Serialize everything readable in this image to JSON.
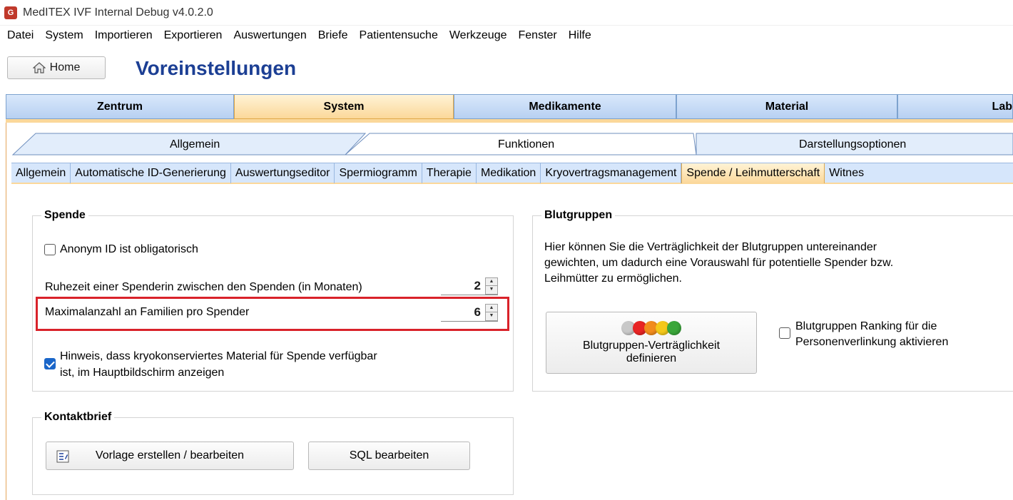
{
  "window": {
    "title": "MedITEX IVF Internal Debug v4.0.2.0",
    "icon_label": "G"
  },
  "menu": [
    "Datei",
    "System",
    "Importieren",
    "Exportieren",
    "Auswertungen",
    "Briefe",
    "Patientensuche",
    "Werkzeuge",
    "Fenster",
    "Hilfe"
  ],
  "header": {
    "home_label": "Home",
    "page_title": "Voreinstellungen"
  },
  "main_tabs": [
    "Zentrum",
    "System",
    "Medikamente",
    "Material",
    "Lab"
  ],
  "main_tab_active": "System",
  "sub_tabs": [
    "Allgemein",
    "Funktionen",
    "Darstellungsoptionen"
  ],
  "sub_tab_active": "Funktionen",
  "third_tabs": [
    "Allgemein",
    "Automatische ID-Generierung",
    "Auswertungseditor",
    "Spermiogramm",
    "Therapie",
    "Medikation",
    "Kryovertragsmanagement",
    "Spende / Leihmutterschaft",
    "Witnes"
  ],
  "third_tab_active": "Spende / Leihmutterschaft",
  "spende": {
    "title": "Spende",
    "anonym_label": "Anonym ID ist obligatorisch",
    "anonym_checked": false,
    "ruhezeit_label": "Ruhezeit einer Spenderin zwischen den Spenden (in Monaten)",
    "ruhezeit_value": "2",
    "max_label": "Maximalanzahl an Familien pro Spender",
    "max_value": "6",
    "hinweis_line1": "Hinweis, dass kryokonserviertes Material für Spende verfügbar",
    "hinweis_line2": "ist, im Hauptbildschirm anzeigen",
    "hinweis_checked": true
  },
  "blutgruppen": {
    "title": "Blutgruppen",
    "desc_line1": "Hier können Sie die Verträglichkeit der Blutgruppen untereinander",
    "desc_line2": "gewichten, um dadurch eine Vorauswahl für potentielle Spender bzw.",
    "desc_line3": "Leihmütter zu ermöglichen.",
    "button_line1": "Blutgruppen-Verträglichkeit",
    "button_line2": "definieren",
    "ranking_line1": "Blutgruppen Ranking für die",
    "ranking_line2": "Personenverlinkung aktivieren",
    "ranking_checked": false,
    "dot_colors": [
      "#c8c8c8",
      "#e82424",
      "#f28c1c",
      "#f4c81a",
      "#3aa63a"
    ]
  },
  "kontaktbrief": {
    "title": "Kontaktbrief",
    "vorlage_label": "Vorlage erstellen / bearbeiten",
    "sql_label": "SQL bearbeiten"
  }
}
